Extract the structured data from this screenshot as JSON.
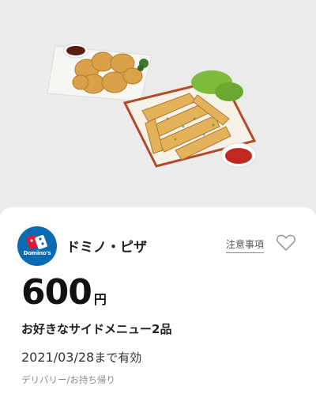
{
  "hero": {
    "image": "side-menu-nuggets-and-potatoes"
  },
  "coupon": {
    "brand_logo_text": "Domino's",
    "brand_name": "ドミノ・ピザ",
    "notes_link": "注意事項",
    "favorite_icon": "heart-outline-icon",
    "price_value": "600",
    "price_unit": "円",
    "description": "お好きなサイドメニュー2品",
    "expiry_date": "2021/03/28",
    "expiry_suffix": "まで有効",
    "method": "デリバリー/お持ち帰り"
  },
  "colors": {
    "background": "#ebebeb",
    "card": "#ffffff",
    "brand_blue": "#0a6ab2",
    "brand_red": "#e31837"
  }
}
